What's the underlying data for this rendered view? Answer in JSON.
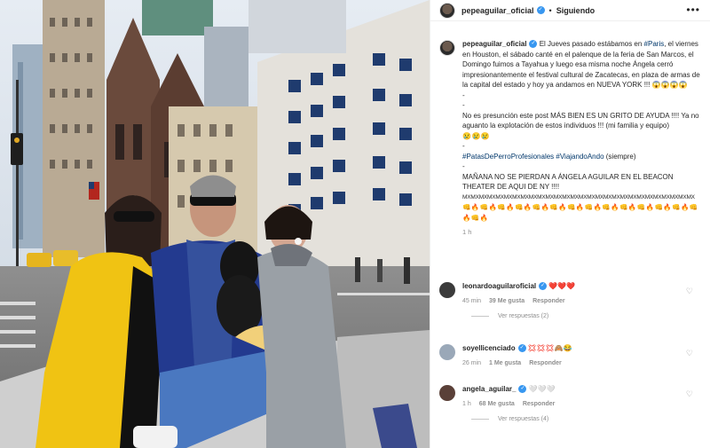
{
  "post": {
    "username": "pepeaguilar_oficial",
    "follow_status": "Siguiendo",
    "more_icon": "more-horizontal-icon",
    "image_alt": "Photo of four people and a black dog on a New York City street"
  },
  "caption": {
    "username": "pepeaguilar_oficial",
    "text_1": " El Jueves pasado estábamos en ",
    "tag_paris": "#Paris",
    "text_2": ", el viernes en Houston, el sábado canté en el palenque de la feria de San Marcos, el Domingo fuimos a Tayahua y luego esa misma noche Ángela cerró impresionantemente el festival cultural de Zacatecas, en plaza de armas de la capital del estado y hoy ya andamos en NUEVA YORK !!! 😱😱😱😱",
    "dash_1": "-",
    "dash_2": "-",
    "text_3": "No es presunción este post MÁS BIEN ES UN GRITO DE AYUDA !!!! Ya no aguanto la explotación de estos individuos !!! (mi familia y equipo)",
    "emoji_line": "😢😢😢",
    "dash_3": "-",
    "tag_patas": "#PatasDePerroProfesionales",
    "tag_viajando": "#ViajandoAndo",
    "text_4": " (siempre)",
    "dash_4": "-",
    "text_5": "MAÑANA NO SE PIERDAN A ÁNGELA AGUILAR EN EL BEACON THEATER DE AQUI DE NY !!!!",
    "mx_line": "MXMXMXMXMXMXMXMXMXMXMXMXMXMXMXMXMXMXMXMXMXMXMXMXMXMXMXMX",
    "emoji_row": "👊🔥👊🔥👊🔥👊🔥👊🔥👊🔥👊🔥👊🔥👊🔥👊🔥👊🔥👊🔥👊🔥👊🔥👊🔥",
    "time": "1 h"
  },
  "comments": [
    {
      "username": "leonardoaguilaroficial",
      "text": "❤️❤️❤️",
      "time": "45 min",
      "likes": "39 Me gusta",
      "reply": "Responder",
      "replies": "Ver respuestas (2)",
      "avatar_color": "#3b3b3b"
    },
    {
      "username": "soyellicenciado",
      "text": "💢💢💢🙈😂",
      "time": "26 min",
      "likes": "1 Me gusta",
      "reply": "Responder",
      "replies": "",
      "avatar_color": "#9aa8b8"
    },
    {
      "username": "angela_aguilar_",
      "text": "🤍🤍🤍",
      "time": "1 h",
      "likes": "68 Me gusta",
      "reply": "Responder",
      "replies": "Ver respuestas (4)",
      "avatar_color": "#5a4038"
    }
  ],
  "colors": {
    "verified": "#3897f0",
    "link": "#00376b",
    "muted": "#8e8e8e"
  }
}
